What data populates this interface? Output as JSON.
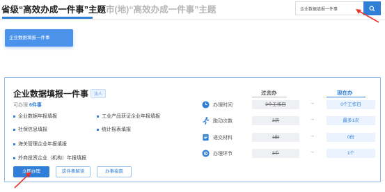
{
  "tabs": {
    "province": "省级“高效办成一件事”主题",
    "city": "市(地)“高效办成一件事”主题"
  },
  "search": {
    "value": "企业数据填报一件事"
  },
  "top_button": {
    "label": "企业数据填报一件事"
  },
  "card": {
    "title": "企业数据填报一件事",
    "tag": "法人",
    "can_handle_prefix": "可办理 ",
    "can_handle_count": "6件事",
    "items": [
      "企业数据年报填报",
      "工业产品获证企业年报填报",
      "社保信息填报",
      "统计报表填报",
      "海关管理企业年报填报",
      "外商投资企业（机构）年报填报"
    ],
    "buttons": {
      "handle": "立即办理",
      "guide": "这件事解读",
      "instructions": "办事指南"
    }
  },
  "comparison": {
    "before_label": "过去办",
    "now_label": "现在办",
    "rows": [
      {
        "icon": "clock-icon",
        "label": "办理时间",
        "before": "9个工作日",
        "now": "0个工作日"
      },
      {
        "icon": "running-icon",
        "label": "跑动次数",
        "before": "3次",
        "now": "最多1次"
      },
      {
        "icon": "document-icon",
        "label": "递交材料",
        "before": "1份",
        "now": "0份"
      },
      {
        "icon": "workflow-icon",
        "label": "办理环节",
        "before": "3个",
        "now": "1个"
      }
    ],
    "arrow": "→"
  },
  "colors": {
    "accent": "#2f7fd8",
    "annotation": "#e8332a"
  }
}
